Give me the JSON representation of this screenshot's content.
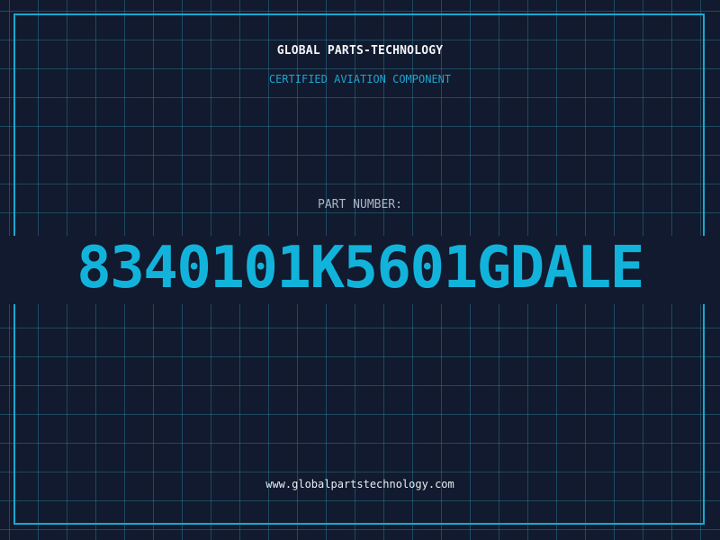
{
  "header": {
    "company_name": "GLOBAL PARTS-TECHNOLOGY",
    "tagline": "CERTIFIED AVIATION COMPONENT"
  },
  "part": {
    "label": "PART NUMBER:",
    "number": "8340101K5601GDALE"
  },
  "footer": {
    "website": "www.globalpartstechnology.com"
  },
  "colors": {
    "background": "#111a2e",
    "grid": "#26708c",
    "accent": "#12b3db",
    "border": "#1aa7cf",
    "title_text": "#f2f4f8",
    "label_text": "#aab7c7"
  }
}
